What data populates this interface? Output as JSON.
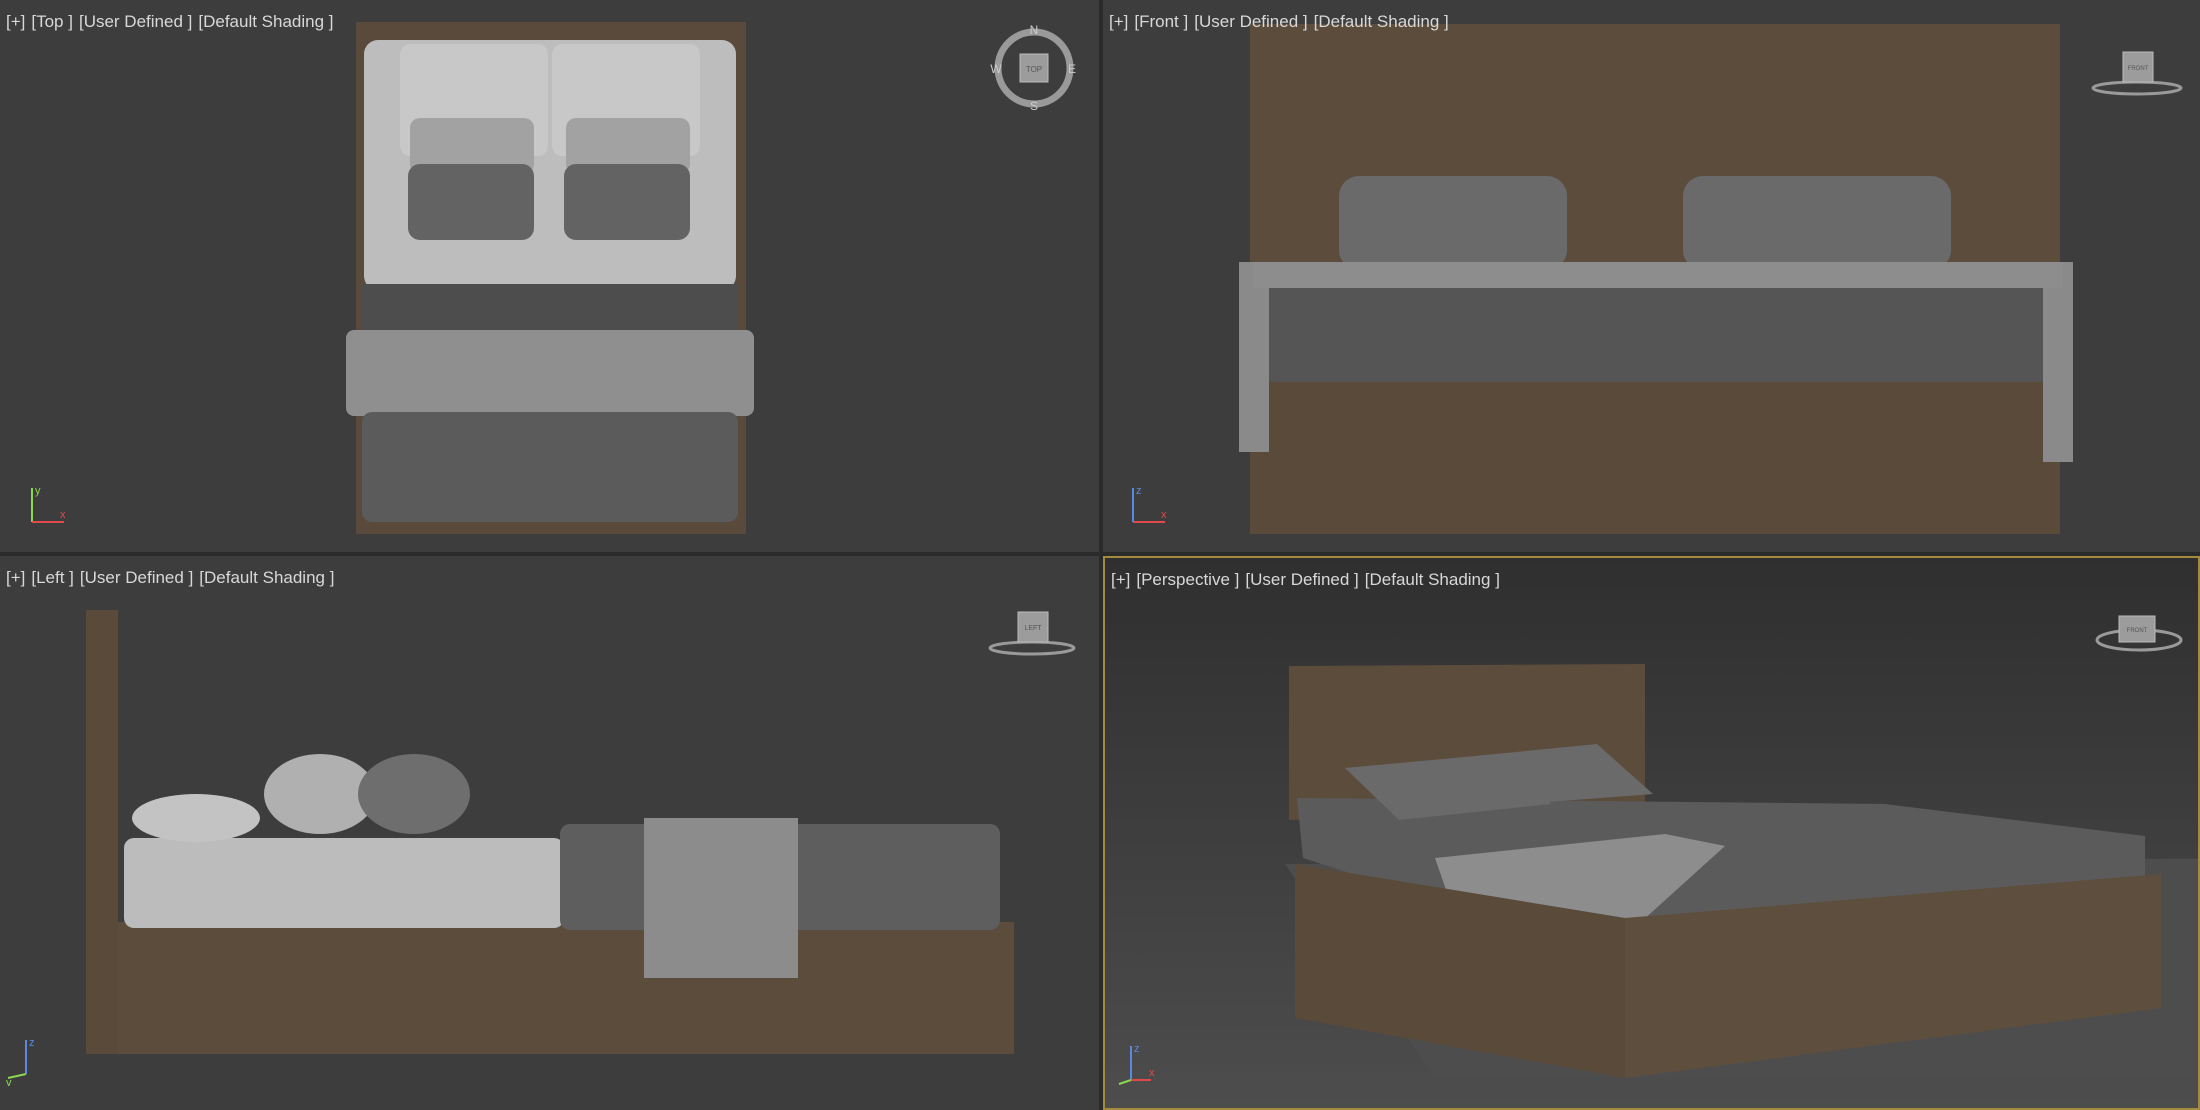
{
  "viewports": {
    "top": {
      "plus": "[+]",
      "view": "[Top ]",
      "mode": "[User Defined ]",
      "shading": "[Default Shading ]"
    },
    "front": {
      "plus": "[+]",
      "view": "[Front ]",
      "mode": "[User Defined ]",
      "shading": "[Default Shading ]"
    },
    "left": {
      "plus": "[+]",
      "view": "[Left ]",
      "mode": "[User Defined ]",
      "shading": "[Default Shading ]"
    },
    "persp": {
      "plus": "[+]",
      "view": "[Perspective ]",
      "mode": "[User Defined ]",
      "shading": "[Default Shading ]"
    }
  },
  "compass": {
    "n": "N",
    "s": "S",
    "e": "E",
    "w": "W"
  },
  "navcubes": {
    "top": "TOP",
    "front": "FRONT",
    "left": "LEFT",
    "persp": "FRONT"
  },
  "axes": {
    "x": "x",
    "y": "y",
    "z": "z"
  },
  "colors": {
    "active_border": "#a38a3c",
    "viewport_bg": "#3d3d3d",
    "wood": "#5e4e3e",
    "fabric_dark": "#5a5a5a",
    "fabric_light": "#a9a9a9"
  }
}
